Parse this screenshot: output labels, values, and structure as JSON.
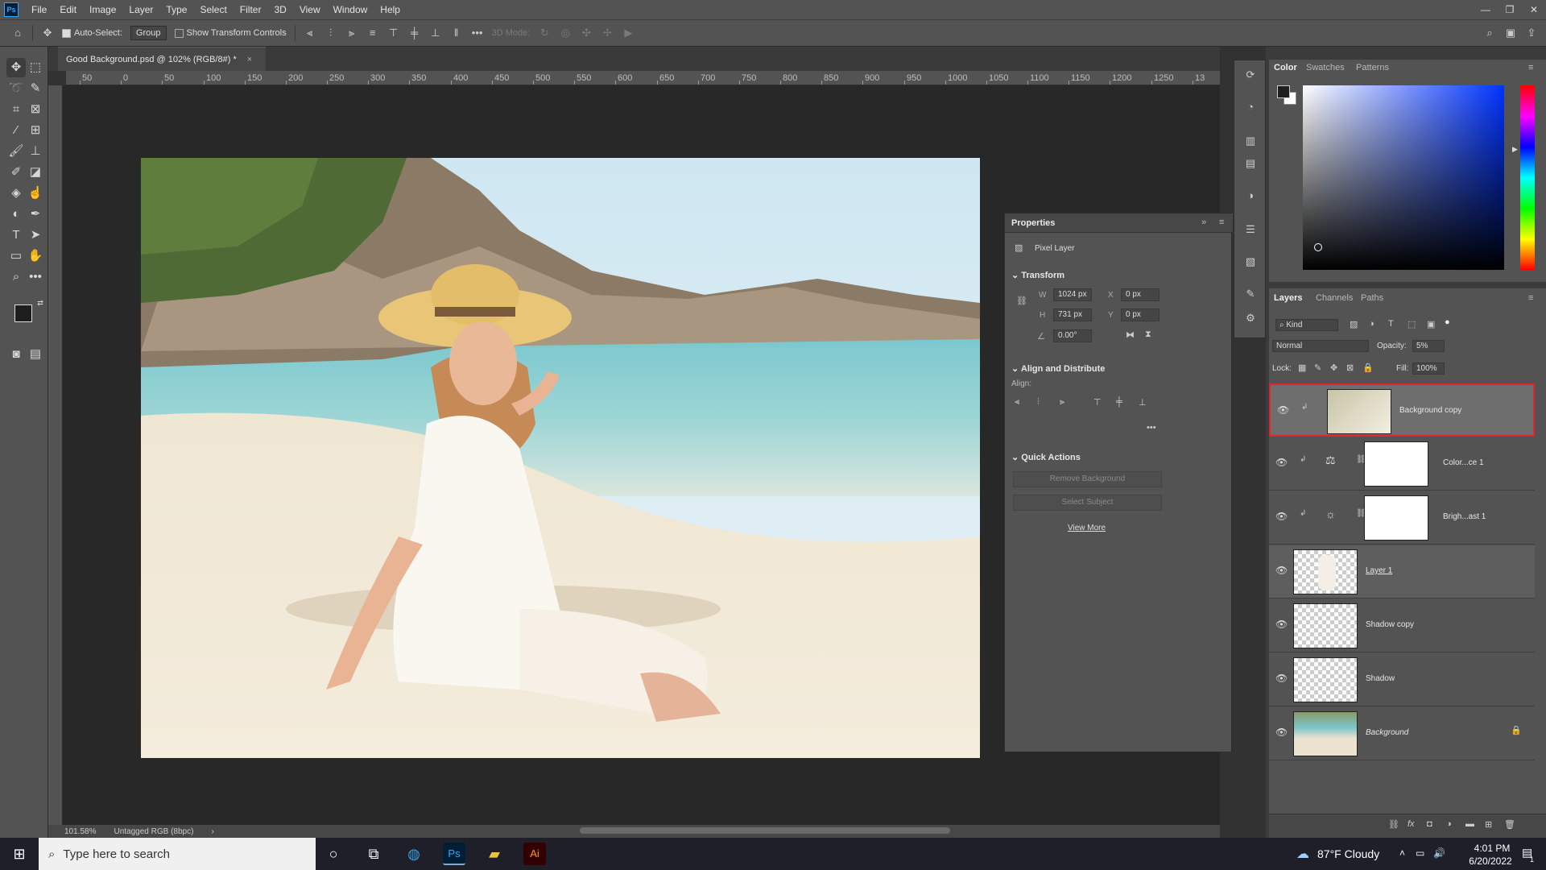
{
  "app": {
    "logo": "Ps",
    "menu": [
      "File",
      "Edit",
      "Image",
      "Layer",
      "Type",
      "Select",
      "Filter",
      "3D",
      "View",
      "Window",
      "Help"
    ],
    "window_controls": [
      "—",
      "❐",
      "✕"
    ]
  },
  "options_bar": {
    "auto_select_label": "Auto-Select:",
    "auto_select_checked": true,
    "auto_select_target": "Group",
    "show_transform_label": "Show Transform Controls",
    "show_transform_checked": false,
    "mode_label": "3D Mode:",
    "more": "•••"
  },
  "document": {
    "tab_title": "Good Background.psd @ 102% (RGB/8#) *",
    "close": "×",
    "zoom": "101.58%",
    "profile": "Untagged RGB (8bpc)",
    "ruler_ticks": [
      "50",
      "0",
      "50",
      "100",
      "150",
      "200",
      "250",
      "300",
      "350",
      "400",
      "450",
      "500",
      "550",
      "600",
      "650",
      "700",
      "750",
      "800",
      "850",
      "900",
      "950",
      "1000",
      "1050",
      "1100",
      "1150",
      "1200",
      "1250",
      "13"
    ]
  },
  "properties": {
    "title": "Properties",
    "layer_type": "Pixel Layer",
    "transform_header": "Transform",
    "w_label": "W",
    "w_value": "1024 px",
    "h_label": "H",
    "h_value": "731 px",
    "x_label": "X",
    "x_value": "0 px",
    "y_label": "Y",
    "y_value": "0 px",
    "angle_value": "0.00°",
    "align_header": "Align and Distribute",
    "align_label": "Align:",
    "quick_actions_header": "Quick Actions",
    "remove_bg": "Remove Background",
    "select_subject": "Select Subject",
    "view_more": "View More"
  },
  "color_panel": {
    "tabs": [
      "Color",
      "Swatches",
      "Patterns"
    ],
    "foreground": "#1e1e1e",
    "background": "#ffffff"
  },
  "layers_panel": {
    "tabs": [
      "Layers",
      "Channels",
      "Paths"
    ],
    "filter_kind": "Kind",
    "blend_mode": "Normal",
    "opacity_label": "Opacity:",
    "opacity_value": "5%",
    "lock_label": "Lock:",
    "fill_label": "Fill:",
    "fill_value": "100%",
    "layers": [
      {
        "name": "Background copy",
        "selected": true,
        "highlighted": true
      },
      {
        "name": "Color...ce 1",
        "selected": false
      },
      {
        "name": "Brigh...ast 1",
        "selected": false
      },
      {
        "name": "Layer 1",
        "selected": false,
        "active": true
      },
      {
        "name": "Shadow copy",
        "selected": false
      },
      {
        "name": "Shadow",
        "selected": false
      },
      {
        "name": "Background",
        "selected": false,
        "locked": true
      }
    ]
  },
  "taskbar": {
    "search_placeholder": "Type here to search",
    "weather": "87°F  Cloudy",
    "time": "4:01 PM",
    "date": "6/20/2022",
    "pinned_app_1": "Ps",
    "pinned_app_2": "Ai",
    "notification_count": "1"
  }
}
